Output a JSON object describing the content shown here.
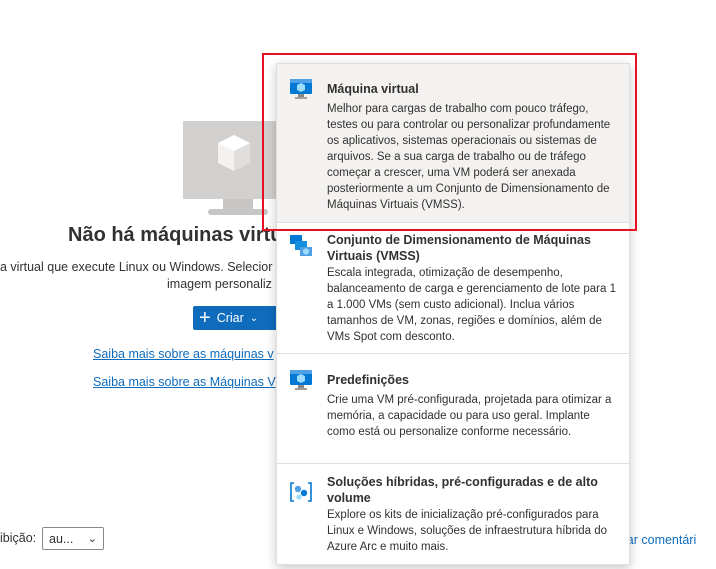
{
  "empty_state": {
    "title": "Não há máquinas virtu",
    "description_line1": "a virtual que execute Linux ou Windows. Selecior",
    "description_line2": "imagem personaliz",
    "create_button": "Criar",
    "link1": "Saiba mais sobre as máquinas v",
    "link2": "Saiba mais sobre as Máquinas V"
  },
  "footer": {
    "view_label": "ibição:",
    "view_value": "au...",
    "feedback": "iar comentári"
  },
  "menu": {
    "items": [
      {
        "title": "Máquina virtual",
        "description": "Melhor para cargas de trabalho com pouco tráfego, testes ou para controlar ou personalizar profundamente os aplicativos, sistemas operacionais ou sistemas de arquivos. Se a sua carga de trabalho ou de tráfego começar a crescer, uma VM poderá ser anexada posteriormente a um Conjunto de Dimensionamento de Máquinas Virtuais (VMSS).",
        "icon": "virtual-machine-icon"
      },
      {
        "title": "Conjunto de Dimensionamento de Máquinas Virtuais (VMSS)",
        "description": "Escala integrada, otimização de desempenho, balanceamento de carga e gerenciamento de lote para 1 a 1.000 VMs (sem custo adicional). Inclua vários tamanhos de VM, zonas, regiões e domínios, além de VMs Spot com desconto.",
        "icon": "vm-scale-set-icon"
      },
      {
        "title": "Predefinições",
        "description": "Crie uma VM pré-configurada, projetada para otimizar a memória, a capacidade ou para uso geral. Implante como está ou personalize conforme necessário.",
        "icon": "preset-vm-icon"
      },
      {
        "title": "Soluções híbridas, pré-configuradas e de alto volume",
        "description": "Explore os kits de inicialização pré-configurados para Linux e Windows, soluções de infraestrutura híbrida do Azure Arc e muito mais.",
        "icon": "hybrid-solutions-icon"
      }
    ]
  },
  "colors": {
    "accent": "#0f6cbd",
    "highlight_border": "#e81123"
  }
}
